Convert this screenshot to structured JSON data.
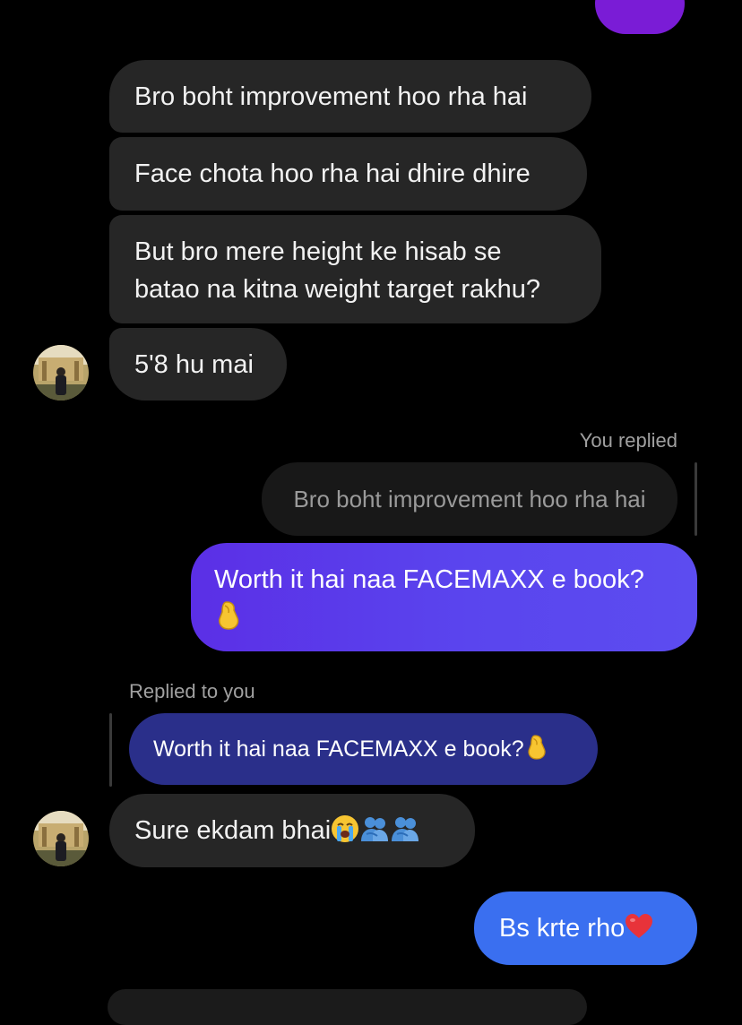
{
  "messages": {
    "incoming": [
      "Bro boht improvement hoo rha hai",
      "Face chota hoo rha hai dhire dhire",
      "But bro mere height ke hisab se",
      "batao na kitna weight target rakhu?",
      "5'8 hu mai"
    ],
    "you_replied_label": "You replied",
    "quoted_message": "Bro boht improvement hoo rha hai",
    "outgoing_reply": "Worth it hai naa FACEMAXX e book?",
    "replied_to_you_label": "Replied to you",
    "quoted_own_message": "Worth it hai naa FACEMAXX e book?",
    "incoming_reply": "Sure ekdam bhai",
    "outgoing_final": "Bs krte rho"
  },
  "emojis": {
    "pinched_fingers": "pinched-fingers-icon",
    "crying": "loudly-crying-face-icon",
    "people_hugging": "people-hugging-icon",
    "heart": "red-heart-icon"
  },
  "colors": {
    "background": "#000000",
    "incoming_bubble": "#262626",
    "outgoing_purple": "#5a45ee",
    "quoted_own_bubble": "#2a2f8a",
    "outgoing_blue": "#3a6ff0",
    "meta_text": "#a0a0a0"
  }
}
